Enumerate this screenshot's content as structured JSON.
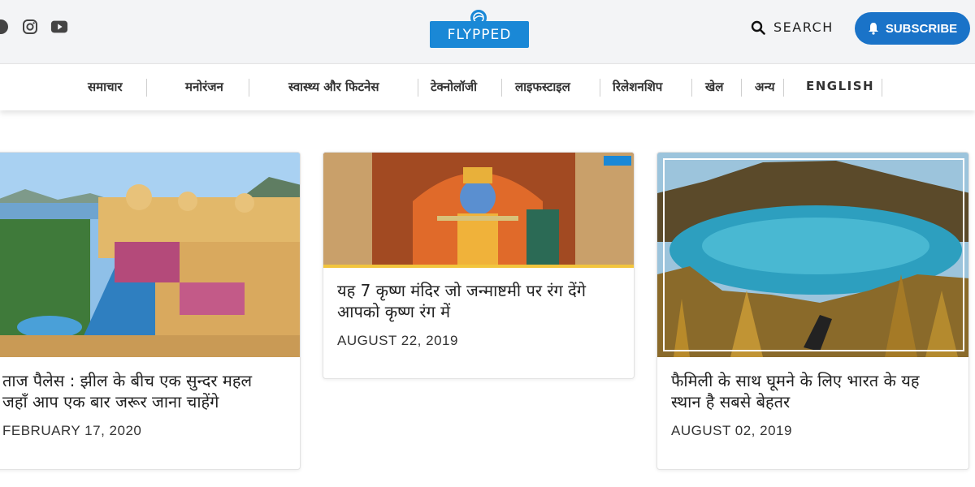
{
  "header": {
    "logo_text": "FLYPPED",
    "search_label": "SEARCH",
    "subscribe_label": "SUBSCRIBE",
    "social_icons": [
      "facebook-icon",
      "instagram-icon",
      "youtube-icon"
    ]
  },
  "nav": {
    "items": [
      {
        "label": "समाचार"
      },
      {
        "label": "मनोरंजन"
      },
      {
        "label": "स्वास्थ्य और फिटनेस"
      },
      {
        "label": "टेक्नोलॉजी"
      },
      {
        "label": "लाइफस्टाइल"
      },
      {
        "label": "रिलेशनशिप"
      },
      {
        "label": "खेल"
      },
      {
        "label": "अन्य"
      },
      {
        "label": "ENGLISH"
      }
    ]
  },
  "cards": [
    {
      "title_line1": "ताज पैलेस : झील के बीच एक सुन्दर महल",
      "title_line2": "जहाँ आप एक बार जरूर जाना चाहेंगे",
      "date": "FEBRUARY 17, 2020",
      "image": "palace-lake-image"
    },
    {
      "title_line1": "यह 7 कृष्ण मंदिर जो जन्माष्टमी पर रंग देंगे",
      "title_line2": "आपको कृष्ण रंग में",
      "date": "AUGUST 22, 2019",
      "image": "krishna-painting-image"
    },
    {
      "title_line1": "फैमिली के साथ घूमने के लिए भारत के यह",
      "title_line2": "स्थान है सबसे बेहतर",
      "date": "AUGUST 02, 2019",
      "image": "mountain-lake-image"
    }
  ],
  "colors": {
    "topbar_bg": "#f3f4f6",
    "brand_blue": "#1a88d6",
    "subscribe_blue": "#1a73c8"
  }
}
